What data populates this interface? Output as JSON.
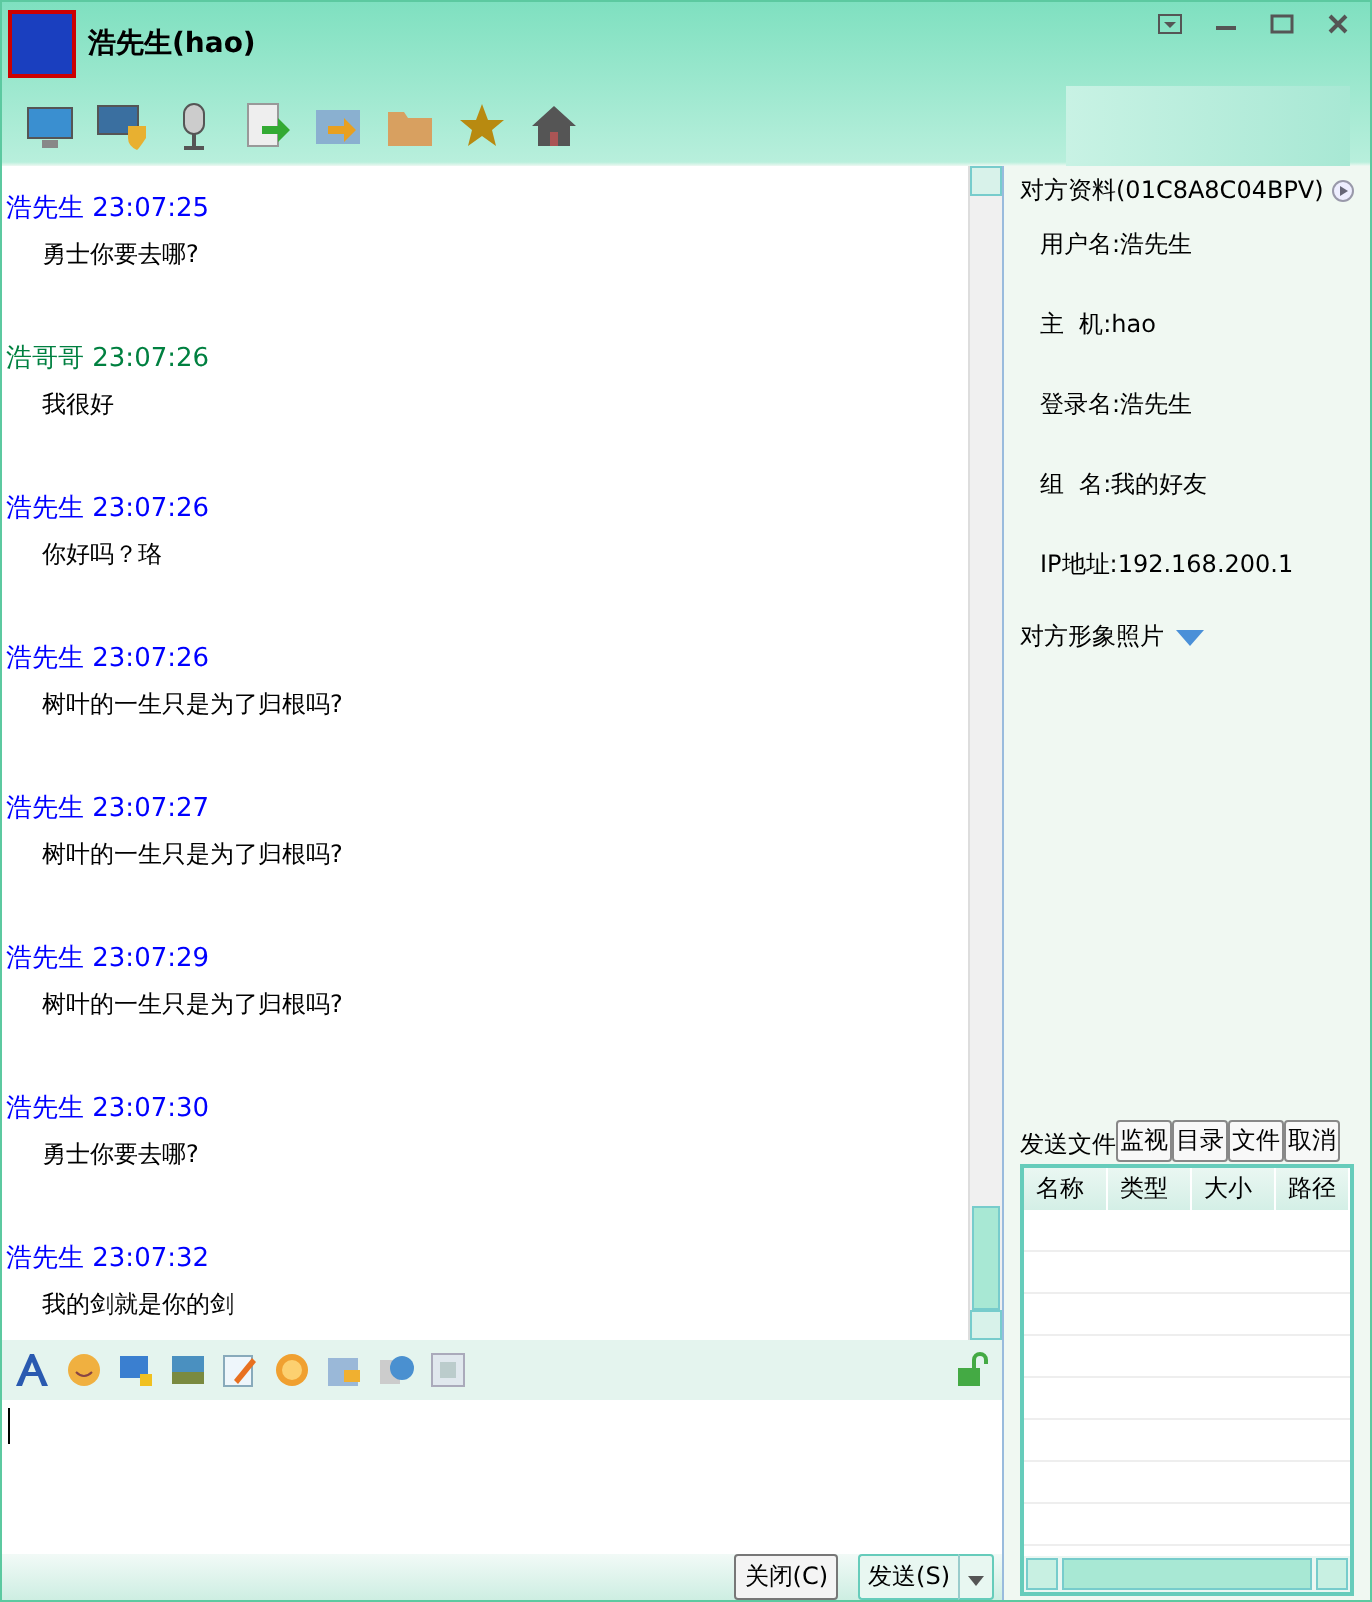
{
  "window": {
    "title": "浩先生(hao)"
  },
  "messages": [
    {
      "sender": "浩先生",
      "time": "23:07:25",
      "text": "勇士你要去哪?",
      "color": "#0000ff"
    },
    {
      "sender": "浩哥哥",
      "time": "23:07:26",
      "text": "我很好",
      "color": "#008040"
    },
    {
      "sender": "浩先生",
      "time": "23:07:26",
      "text": "你好吗？珞",
      "color": "#0000ff"
    },
    {
      "sender": "浩先生",
      "time": "23:07:26",
      "text": "树叶的一生只是为了归根吗?",
      "color": "#0000ff"
    },
    {
      "sender": "浩先生",
      "time": "23:07:27",
      "text": "树叶的一生只是为了归根吗?",
      "color": "#0000ff"
    },
    {
      "sender": "浩先生",
      "time": "23:07:29",
      "text": "树叶的一生只是为了归根吗?",
      "color": "#0000ff"
    },
    {
      "sender": "浩先生",
      "time": "23:07:30",
      "text": "勇士你要去哪?",
      "color": "#0000ff"
    },
    {
      "sender": "浩先生",
      "time": "23:07:32",
      "text": "我的剑就是你的剑",
      "color": "#0000ff"
    }
  ],
  "profile": {
    "heading": "对方资料(01C8A8C04BPV)",
    "fields": [
      "用户名:浩先生",
      "主  机:hao",
      "登录名:浩先生",
      "组  名:我的好友",
      "IP地址:192.168.200.1"
    ],
    "photo_label": "对方形象照片"
  },
  "file_panel": {
    "label": "发送文件",
    "buttons": [
      "监视",
      "目录",
      "文件",
      "取消"
    ],
    "columns": [
      "名称",
      "类型",
      "大小",
      "路径"
    ]
  },
  "buttons": {
    "close": "关闭(C)",
    "send": "发送(S)"
  }
}
